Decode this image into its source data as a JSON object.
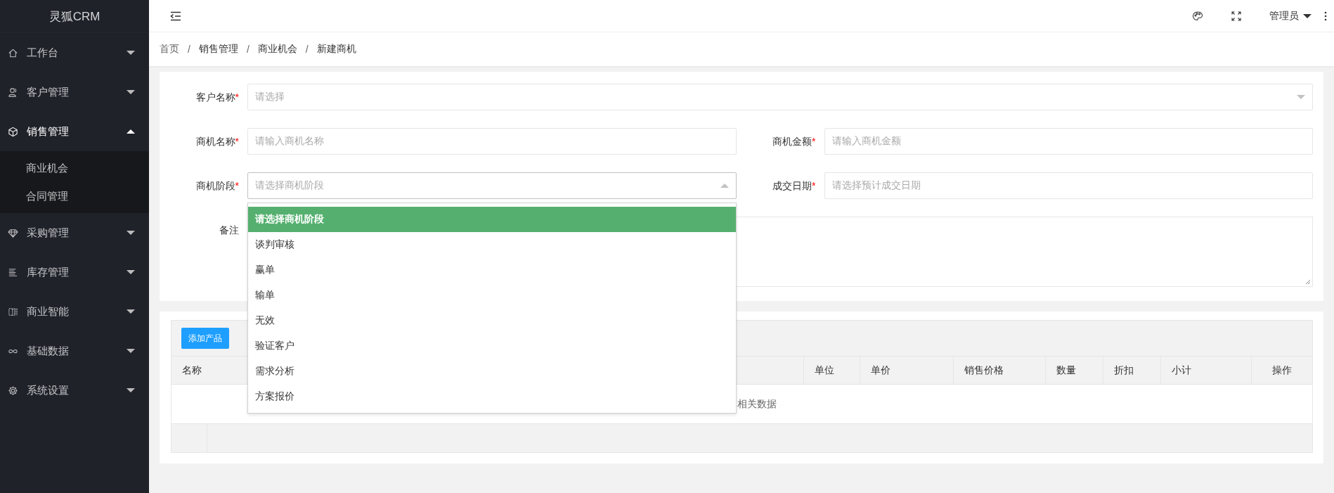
{
  "sidebar": {
    "logo": "灵狐CRM",
    "items": [
      {
        "label": "工作台",
        "expanded": false
      },
      {
        "label": "客户管理",
        "expanded": false
      },
      {
        "label": "销售管理",
        "expanded": true,
        "children": [
          {
            "label": "商业机会",
            "selected": false
          },
          {
            "label": "合同管理",
            "selected": false
          }
        ]
      },
      {
        "label": "采购管理",
        "expanded": false
      },
      {
        "label": "库存管理",
        "expanded": false
      },
      {
        "label": "商业智能",
        "expanded": false
      },
      {
        "label": "基础数据",
        "expanded": false
      },
      {
        "label": "系统设置",
        "expanded": false
      }
    ]
  },
  "topbar": {
    "user": "管理员"
  },
  "breadcrumb": [
    "首页",
    "/",
    "销售管理",
    "/",
    "商业机会",
    "/",
    "新建商机"
  ],
  "form": {
    "rows": [
      [
        {
          "label": "客户名称",
          "required_mark": "*",
          "kind": "select",
          "placeholder": "请选择",
          "open": false
        }
      ],
      [
        {
          "label": "商机名称",
          "required_mark": "*",
          "kind": "input",
          "placeholder": "请输入商机名称"
        },
        {
          "label": "商机金额",
          "required_mark": "*",
          "kind": "input",
          "placeholder": "请输入商机金额"
        }
      ],
      [
        {
          "label": "商机阶段",
          "required_mark": "*",
          "kind": "select",
          "placeholder": "请选择商机阶段",
          "open": true
        },
        {
          "label": "成交日期",
          "required_mark": "*",
          "kind": "input",
          "placeholder": "请选择预计成交日期"
        }
      ],
      [
        {
          "label": "备注",
          "kind": "textarea"
        }
      ]
    ],
    "dropdown": {
      "options": [
        {
          "label": "请选择商机阶段",
          "selected": true
        },
        {
          "label": "谈判审核",
          "selected": false
        },
        {
          "label": "赢单",
          "selected": false
        },
        {
          "label": "输单",
          "selected": false
        },
        {
          "label": "无效",
          "selected": false
        },
        {
          "label": "验证客户",
          "selected": false
        },
        {
          "label": "需求分析",
          "selected": false
        },
        {
          "label": "方案报价",
          "selected": false
        }
      ]
    }
  },
  "products": {
    "add_button": "添加产品",
    "columns": [
      "名称",
      "单位",
      "单价",
      "销售价格",
      "数量",
      "折扣",
      "小计",
      "操作"
    ],
    "empty_text": "相关数据"
  }
}
